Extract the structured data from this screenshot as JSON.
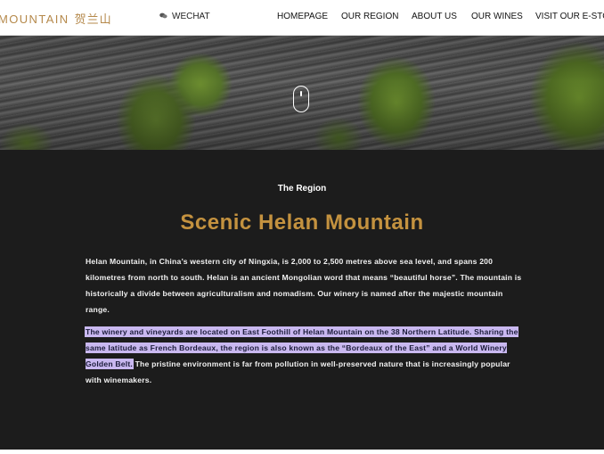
{
  "header": {
    "brand_en": "MOUNTAIN",
    "brand_cn": "贺兰山",
    "wechat_label": "WECHAT",
    "nav": [
      {
        "label": "HOMEPAGE"
      },
      {
        "label": "OUR REGION"
      },
      {
        "label": "ABOUT US"
      },
      {
        "label": "OUR WINES"
      },
      {
        "label": "VISIT OUR E-STORE"
      }
    ]
  },
  "hero": {
    "scroll_icon": "mouse-scroll-icon"
  },
  "section": {
    "eyebrow": "The Region",
    "title": "Scenic Helan Mountain",
    "paragraph1": "Helan Mountain, in China’s western city of Ningxia, is 2,000 to 2,500 metres above sea level, and spans 200 kilometres from north to south. Helan is an ancient Mongolian word that means “beautiful horse”. The mountain is historically a divide between agriculturalism and nomadism. Our winery is named after the majestic mountain range.",
    "paragraph2_highlighted": "The winery and vineyards are located on East Foothill of Helan Mountain on the 38 Northern Latitude. Sharing the same latitude as French Bordeaux, the region is also known as the “Bordeaux of the East” and a World Winery Golden Belt.",
    "paragraph2_rest": " The pristine environment is far from pollution in well-preserved nature that is increasingly popular with winemakers."
  },
  "colors": {
    "accent_gold": "#c4923f",
    "section_bg": "#1c1c1c",
    "selection_highlight": "#c9b8f0"
  }
}
